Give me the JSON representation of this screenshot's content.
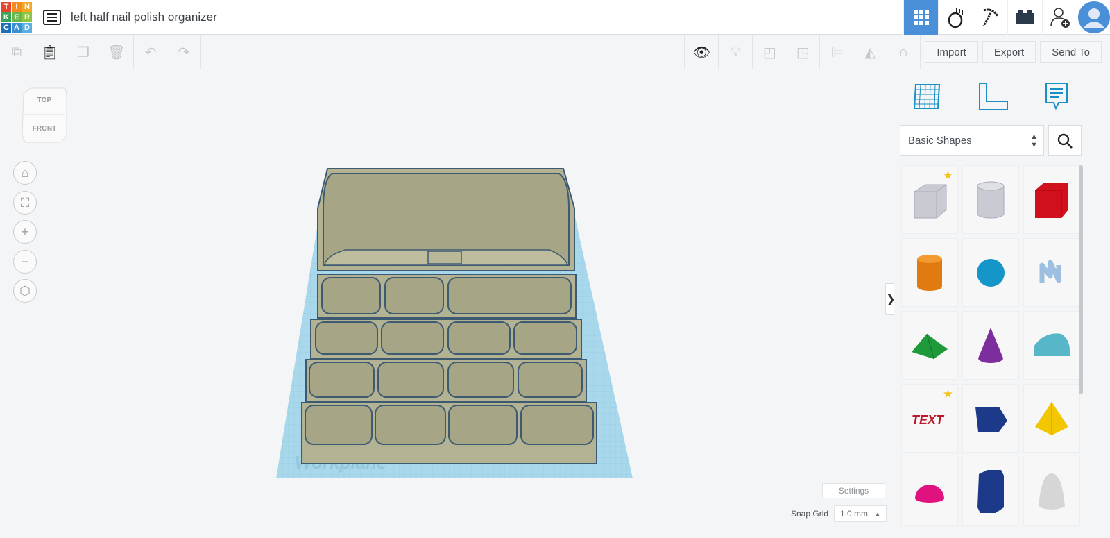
{
  "header": {
    "logo_letters": [
      "T",
      "I",
      "N",
      "K",
      "E",
      "R",
      "C",
      "A",
      "D"
    ],
    "title": "left half nail polish organizer",
    "icons": [
      "grid-view-icon",
      "egg-icon",
      "pickaxe-icon",
      "brick-icon",
      "add-user-icon",
      "avatar-icon"
    ]
  },
  "toolbar": {
    "import": "Import",
    "export": "Export",
    "send_to": "Send To"
  },
  "viewcube": {
    "top": "TOP",
    "front": "FRONT"
  },
  "workplane": {
    "label": "Workplane"
  },
  "settings": "Settings",
  "snap": {
    "label": "Snap Grid",
    "value": "1.0 mm"
  },
  "panel": {
    "category": "Basic Shapes",
    "shapes": [
      "Box",
      "Cylinder",
      "Box",
      "Cylinder",
      "Sphere",
      "Scribble",
      "Roof",
      "Cone",
      "Round Roof",
      "Text",
      "Wedge",
      "Pyramid",
      "Half Sphere",
      "Polygon",
      "Paraboloid"
    ],
    "text_shape_label": "TEXT"
  },
  "colors": {
    "accent": "#4a90d9",
    "model": "#b3b393",
    "outline": "#3d5a73",
    "workplane": "#a9d8ec"
  }
}
